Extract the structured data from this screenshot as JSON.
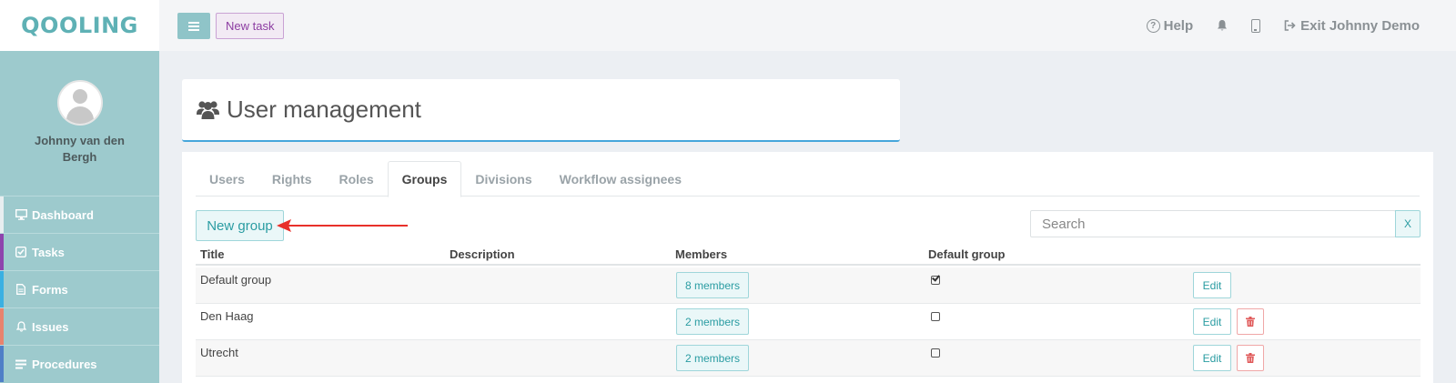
{
  "app": {
    "logo": "QOOLING"
  },
  "sidebar": {
    "user_name": "Johnny van den Bergh",
    "items": [
      {
        "label": "Dashboard",
        "icon": "monitor-icon",
        "color": "#e8eef0"
      },
      {
        "label": "Tasks",
        "icon": "check-square-icon",
        "color": "#8e44ad"
      },
      {
        "label": "Forms",
        "icon": "document-icon",
        "color": "#3ab0e2"
      },
      {
        "label": "Issues",
        "icon": "bell-icon",
        "color": "#e8836e"
      },
      {
        "label": "Procedures",
        "icon": "list-icon",
        "color": "#4f7fc7"
      }
    ]
  },
  "topbar": {
    "new_task": "New task",
    "help": "Help",
    "exit": "Exit Johnny Demo"
  },
  "page": {
    "title": "User management"
  },
  "tabs": [
    "Users",
    "Rights",
    "Roles",
    "Groups",
    "Divisions",
    "Workflow assignees"
  ],
  "active_tab": "Groups",
  "toolbar": {
    "new_group": "New group",
    "search_placeholder": "Search",
    "clear": "X"
  },
  "table": {
    "headers": [
      "Title",
      "Description",
      "Members",
      "Default group"
    ],
    "rows": [
      {
        "title": "Default group",
        "description": "",
        "members": "8 members",
        "default": true,
        "edit": "Edit",
        "deletable": false
      },
      {
        "title": "Den Haag",
        "description": "",
        "members": "2 members",
        "default": false,
        "edit": "Edit",
        "deletable": true
      },
      {
        "title": "Utrecht",
        "description": "",
        "members": "2 members",
        "default": false,
        "edit": "Edit",
        "deletable": true
      }
    ]
  },
  "colors": {
    "accent": "#46a6db",
    "sidebar": "#9dcacd",
    "arrow": "#e8302a"
  }
}
